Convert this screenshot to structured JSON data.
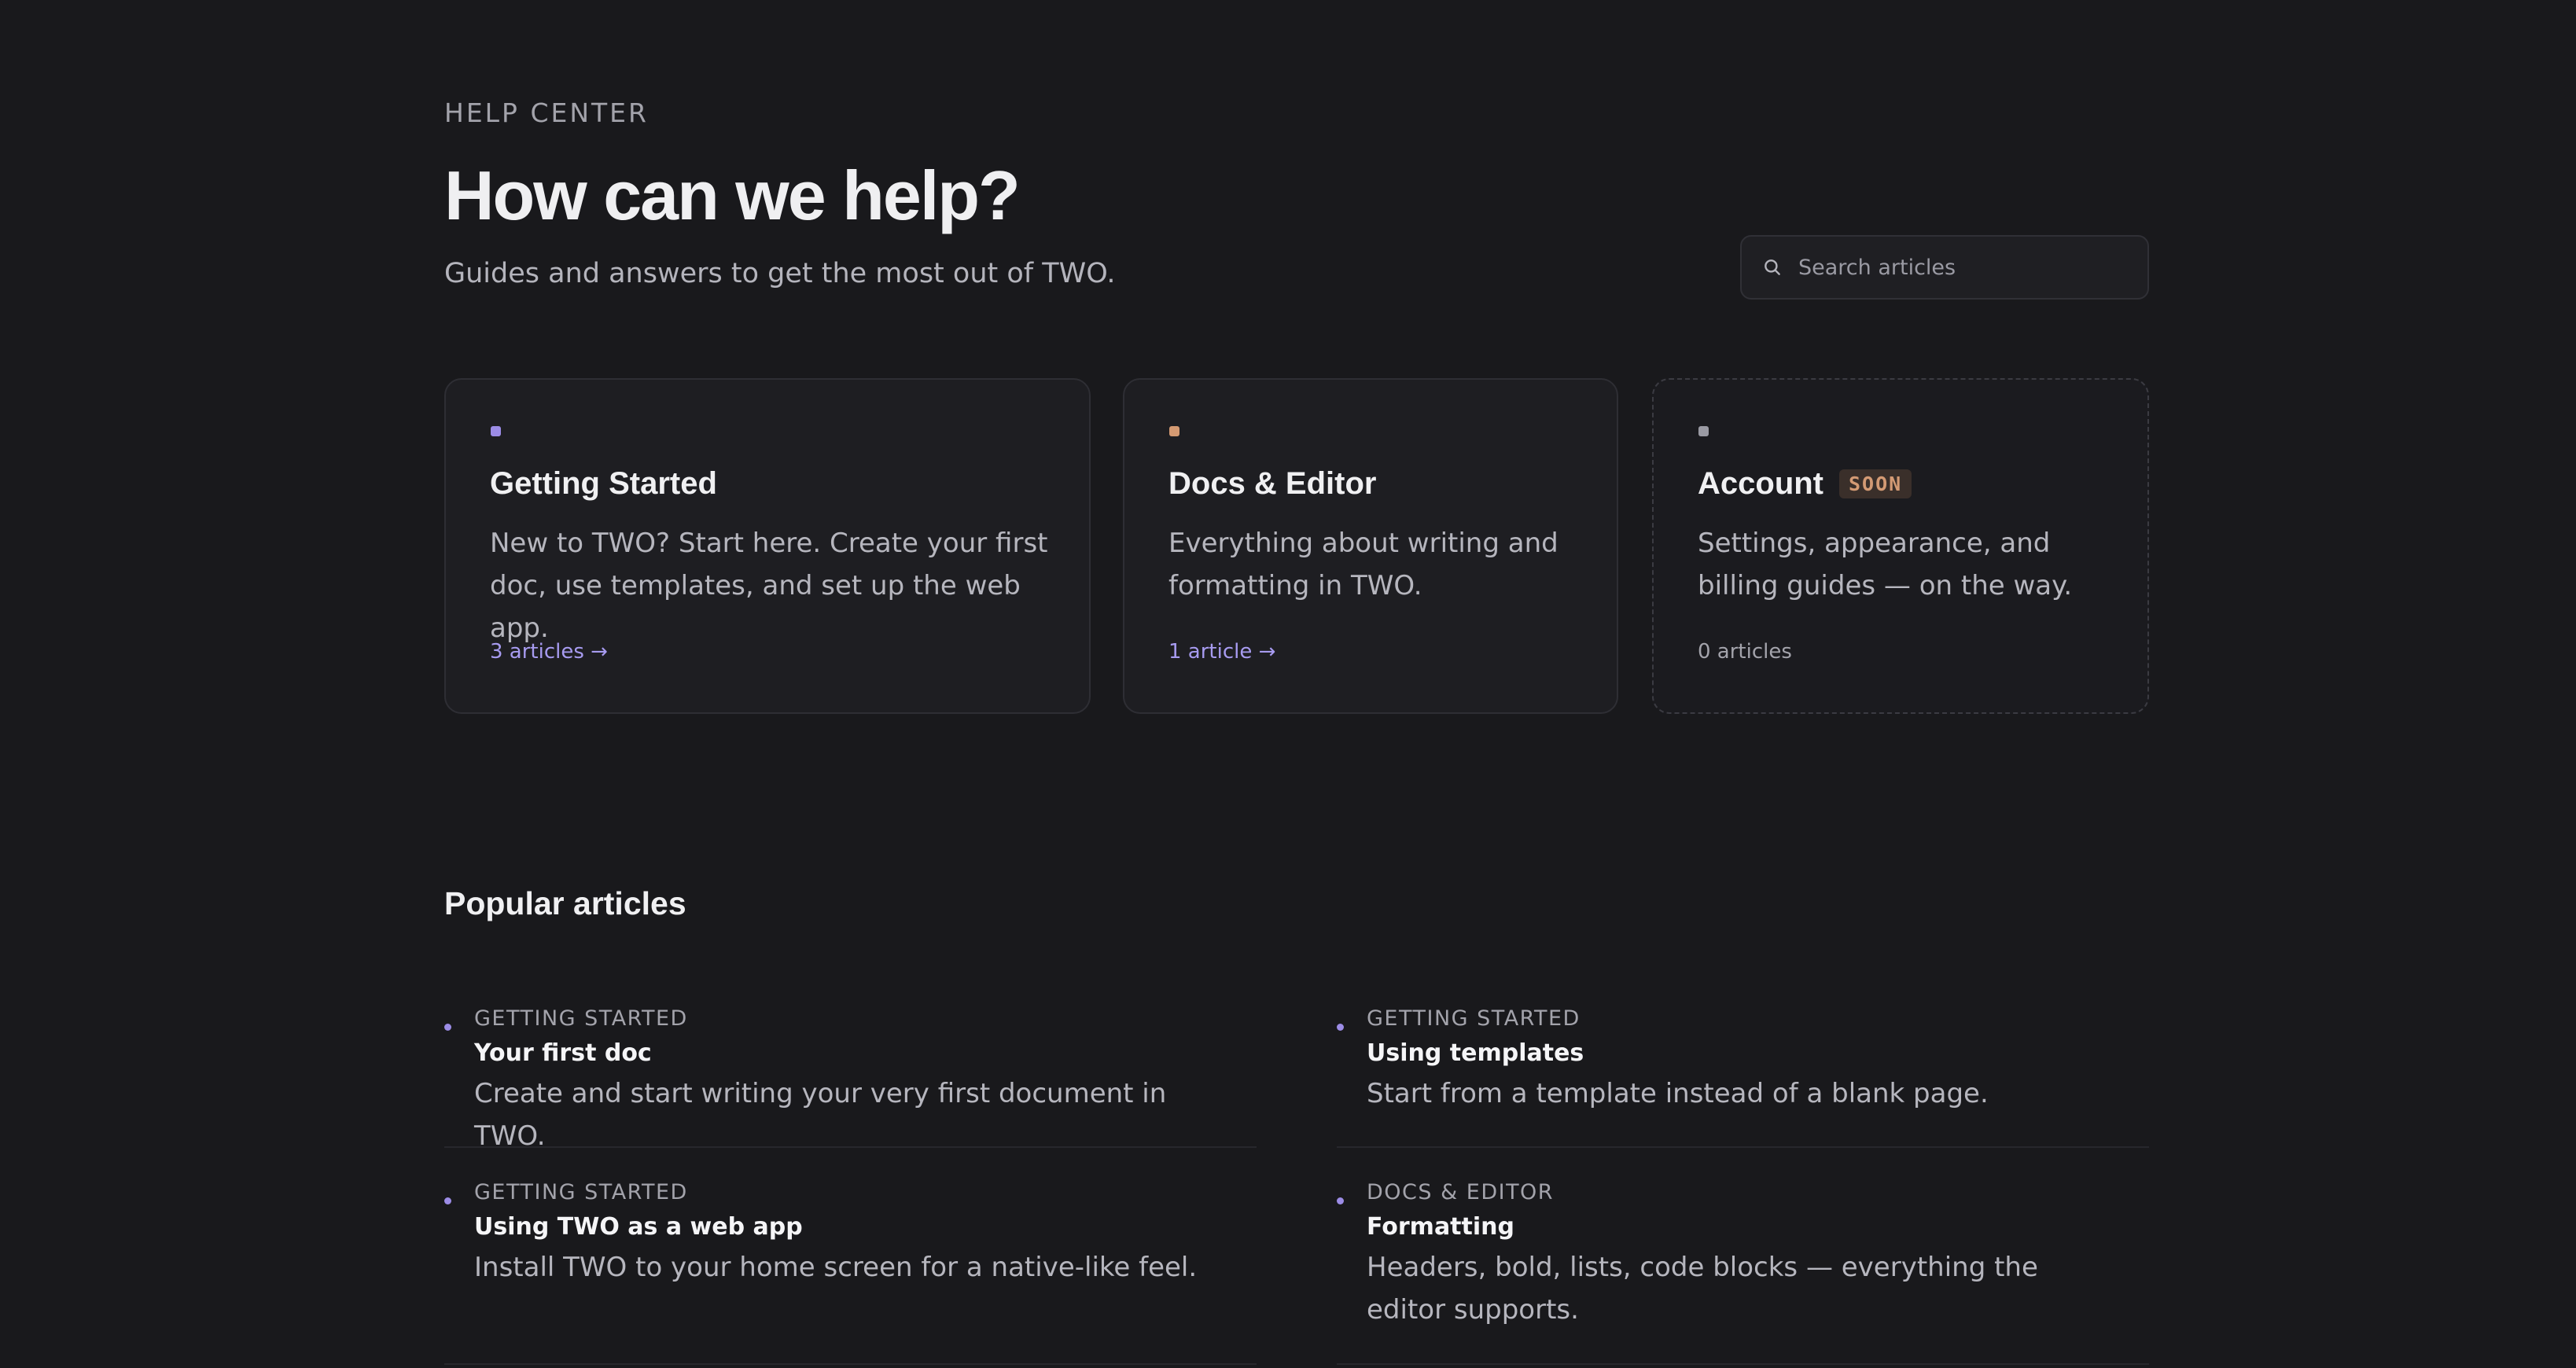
{
  "header": {
    "eyebrow": "HELP CENTER",
    "title": "How can we help?",
    "subtitle": "Guides and answers to get the most out of TWO."
  },
  "search": {
    "placeholder": "Search articles",
    "icon": "search-icon"
  },
  "categories": [
    {
      "title": "Getting Started",
      "description": "New to TWO? Start here. Create your first doc, use templates, and set up the web app.",
      "link": "3 articles →",
      "dot_color": "#9c8ce6"
    },
    {
      "title": "Docs & Editor",
      "description": "Everything about writing and formatting in TWO.",
      "link": "1 article →",
      "dot_color": "#d49a72"
    },
    {
      "title": "Account",
      "badge": "SOON",
      "description": "Settings, appearance, and billing guides — on the way.",
      "link": "0 articles",
      "dot_color": "#9a9aa3"
    }
  ],
  "popular": {
    "title": "Popular articles",
    "articles": [
      {
        "category": "GETTING STARTED",
        "title": "Your first doc",
        "description": "Create and start writing your very first document in TWO."
      },
      {
        "category": "GETTING STARTED",
        "title": "Using templates",
        "description": "Start from a template instead of a blank page."
      },
      {
        "category": "GETTING STARTED",
        "title": "Using TWO as a web app",
        "description": "Install TWO to your home screen for a native-like feel."
      },
      {
        "category": "DOCS & EDITOR",
        "title": "Formatting",
        "description": "Headers, bold, lists, code blocks — everything the editor supports."
      }
    ]
  },
  "colors": {
    "background": "#19191c",
    "accent": "#a79bf0",
    "badge": "#d39a74"
  }
}
